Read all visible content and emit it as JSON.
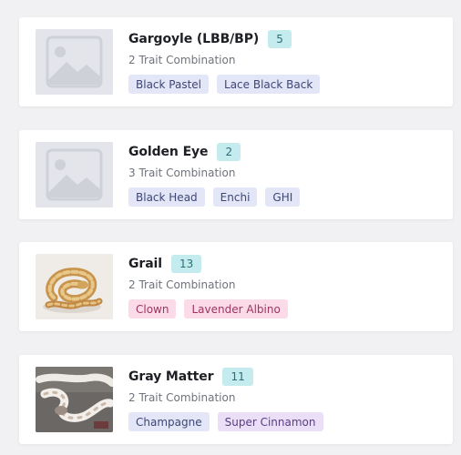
{
  "colors": {
    "background": "#f1f1f3",
    "card": "#ffffff",
    "count_badge_bg": "#c4ecef",
    "trait_blue_bg": "#e2e6f6",
    "trait_pink_bg": "#fcdbe8",
    "trait_purple_bg": "#eadff6"
  },
  "items": [
    {
      "name": "Gargoyle (LBB/BP)",
      "count": "5",
      "subtitle": "2 Trait Combination",
      "image": "placeholder-image-icon",
      "traits": [
        {
          "label": "Black Pastel",
          "color": "blue"
        },
        {
          "label": "Lace Black Back",
          "color": "blue"
        }
      ]
    },
    {
      "name": "Golden Eye",
      "count": "2",
      "subtitle": "3 Trait Combination",
      "image": "placeholder-image-icon",
      "traits": [
        {
          "label": "Black Head",
          "color": "blue"
        },
        {
          "label": "Enchi",
          "color": "blue"
        },
        {
          "label": "GHI",
          "color": "blue"
        }
      ]
    },
    {
      "name": "Grail",
      "count": "13",
      "subtitle": "2 Trait Combination",
      "image": "snake-photo-grail",
      "traits": [
        {
          "label": "Clown",
          "color": "pink"
        },
        {
          "label": "Lavender Albino",
          "color": "pink"
        }
      ]
    },
    {
      "name": "Gray Matter",
      "count": "11",
      "subtitle": "2 Trait Combination",
      "image": "snake-photo-gray-matter",
      "traits": [
        {
          "label": "Champagne",
          "color": "blue"
        },
        {
          "label": "Super Cinnamon",
          "color": "purple"
        }
      ]
    }
  ]
}
